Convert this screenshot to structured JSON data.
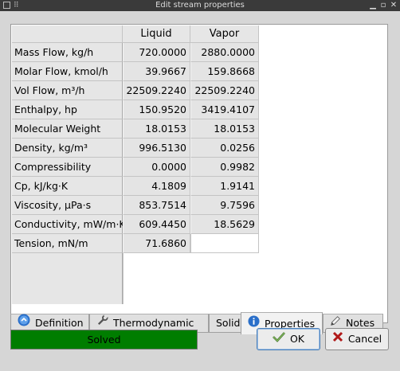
{
  "window": {
    "title": "Edit stream properties",
    "controls": [
      "minimize",
      "maximize",
      "close"
    ]
  },
  "table": {
    "columns": [
      "Liquid",
      "Vapor"
    ],
    "rows": [
      {
        "label": "Mass Flow, kg/h",
        "liquid": "720.0000",
        "vapor": "2880.0000"
      },
      {
        "label": "Molar Flow, kmol/h",
        "liquid": "39.9667",
        "vapor": "159.8668"
      },
      {
        "label": "Vol Flow, m³/h",
        "liquid": "22509.2240",
        "vapor": "22509.2240"
      },
      {
        "label": "Enthalpy, hp",
        "liquid": "150.9520",
        "vapor": "3419.4107"
      },
      {
        "label": "Molecular Weight",
        "liquid": "18.0153",
        "vapor": "18.0153"
      },
      {
        "label": "Density, kg/m³",
        "liquid": "996.5130",
        "vapor": "0.0256"
      },
      {
        "label": "Compressibility",
        "liquid": "0.0000",
        "vapor": "0.9982"
      },
      {
        "label": "Cp, kJ/kg·K",
        "liquid": "4.1809",
        "vapor": "1.9141"
      },
      {
        "label": "Viscosity, µPa·s",
        "liquid": "853.7514",
        "vapor": "9.7596"
      },
      {
        "label": "Conductivity, mW/m·K",
        "liquid": "609.4450",
        "vapor": "18.5629"
      },
      {
        "label": "Tension, mN/m",
        "liquid": "71.6860",
        "vapor": ""
      }
    ]
  },
  "tabs": [
    {
      "label": "Definition",
      "icon": "info-globe-icon"
    },
    {
      "label": "Thermodynamic",
      "icon": "wrench-icon"
    },
    {
      "label": "Solid",
      "icon": ""
    },
    {
      "label": "Properties",
      "icon": "info-icon",
      "active": true
    },
    {
      "label": "Notes",
      "icon": "pencil-icon"
    }
  ],
  "status": {
    "text": "Solved",
    "color": "#007d00"
  },
  "buttons": {
    "ok": "OK",
    "cancel": "Cancel"
  }
}
